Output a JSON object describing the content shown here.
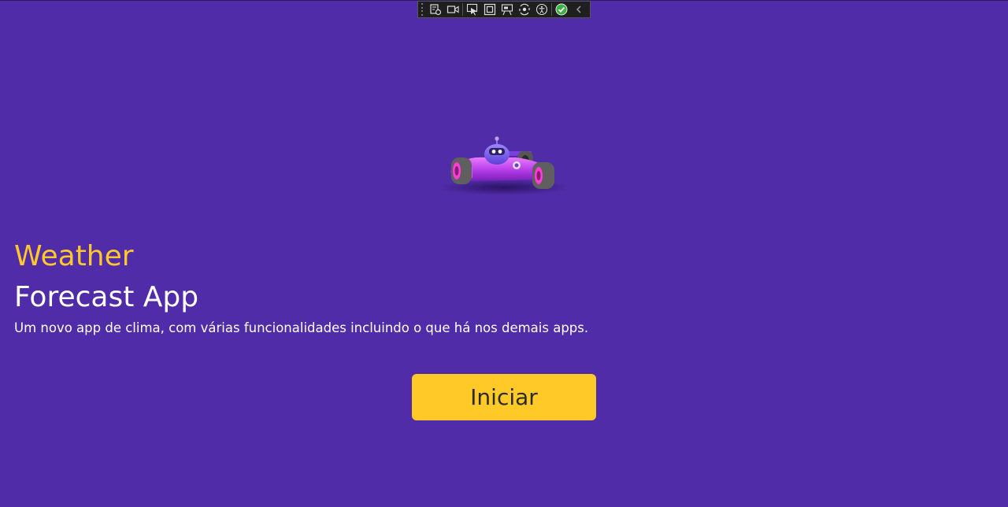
{
  "debug_toolbar": {
    "tools": [
      {
        "icon": "live-visual-tree-icon"
      },
      {
        "icon": "video-camera-icon"
      },
      {
        "icon": "select-element-icon"
      },
      {
        "icon": "display-layout-adorners-icon"
      },
      {
        "icon": "track-focused-element-icon"
      },
      {
        "icon": "hot-reload-icon"
      },
      {
        "icon": "accessibility-icon"
      },
      {
        "icon": "hot-reload-status-icon"
      },
      {
        "icon": "collapse-chevron-icon"
      }
    ],
    "status_color": "#3cb043"
  },
  "hero": {
    "image": "race-car-robot-illustration"
  },
  "title": {
    "accent": "Weather",
    "main": "Forecast App"
  },
  "subtitle": "Um novo app de clima, com várias funcionalidades incluindo o que há nos demais apps.",
  "start_button": {
    "label": "Iniciar"
  },
  "colors": {
    "background": "#512ca8",
    "accent": "#ffc82a",
    "button": "#ffca28",
    "text": "#ffffff"
  }
}
